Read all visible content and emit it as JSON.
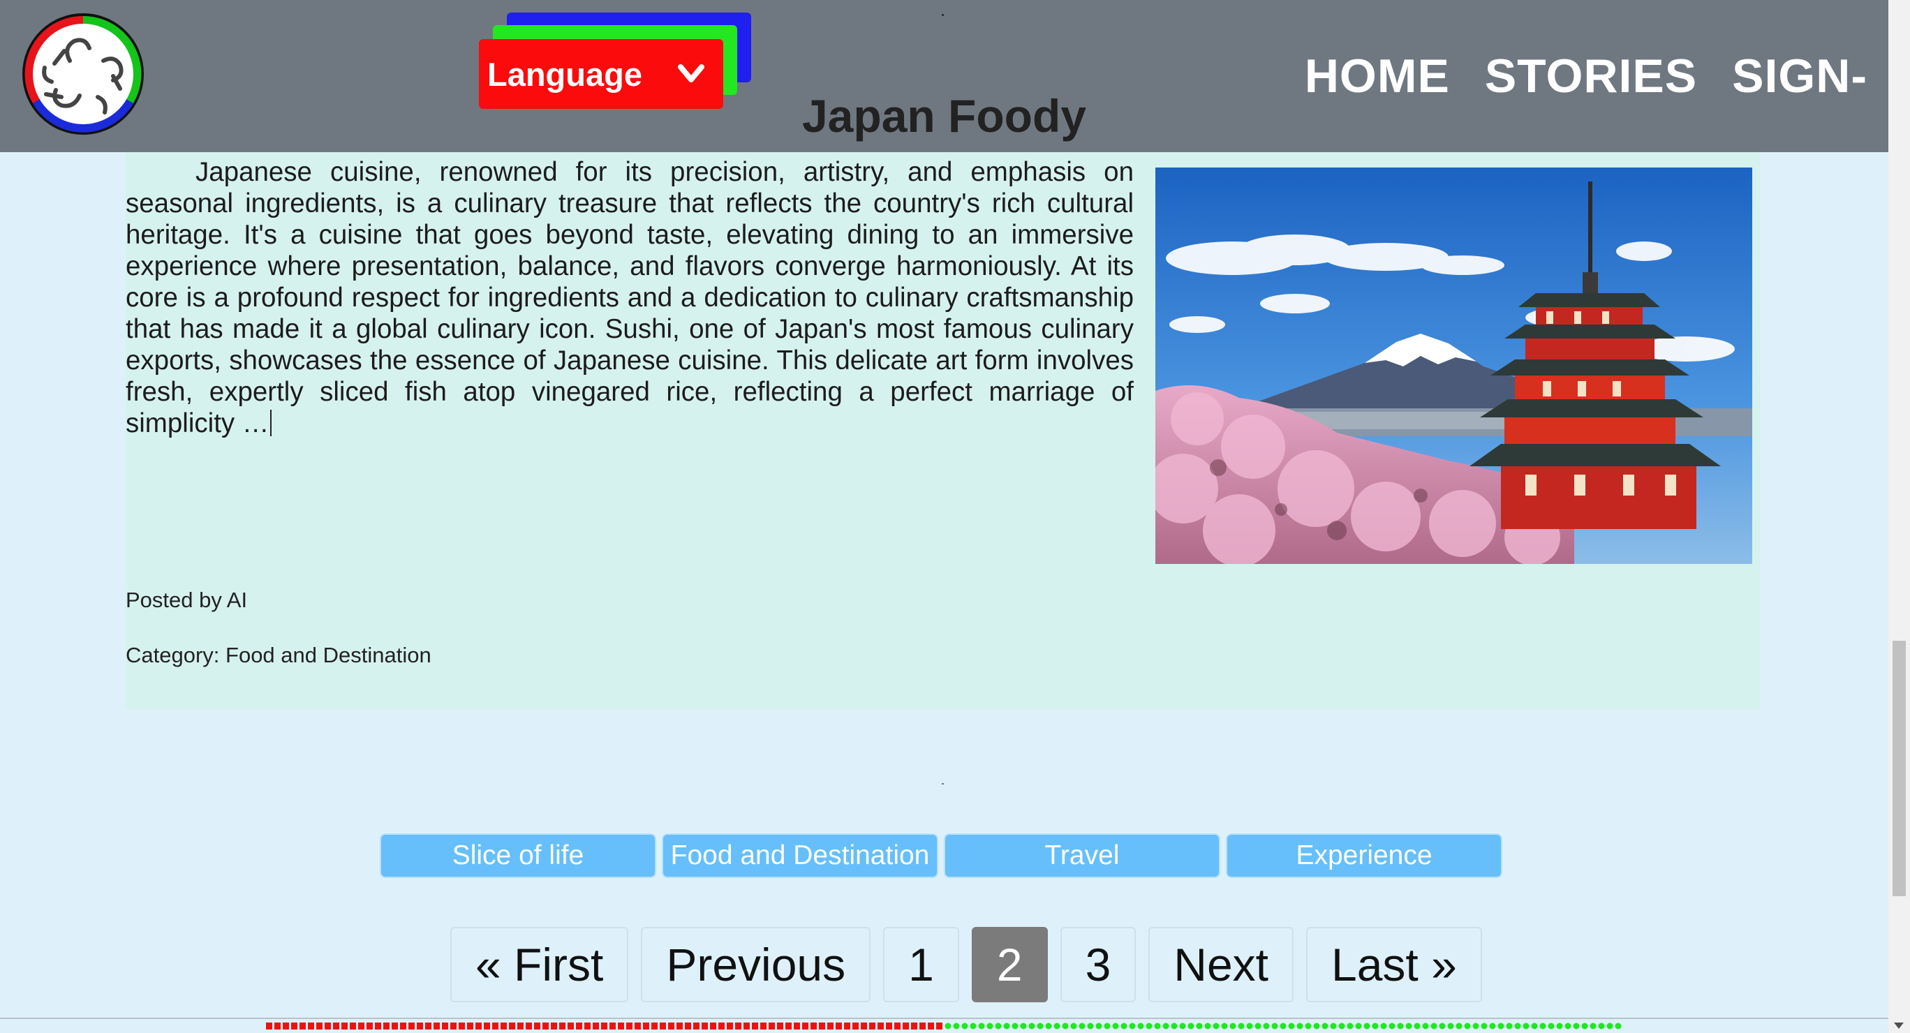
{
  "header": {
    "language_label": "Language",
    "nav": [
      {
        "label": "HOME"
      },
      {
        "label": "STORIES"
      },
      {
        "label": "SIGN-"
      }
    ]
  },
  "article": {
    "title": "Japan Foody",
    "body": "Japanese cuisine, renowned for its precision, artistry, and emphasis on seasonal ingredients, is a culinary treasure that reflects the country's rich cultural heritage. It's a cuisine that goes beyond taste, elevating dining to an immersive experience where presentation, balance, and flavors converge harmoniously. At its core is a profound respect for ingredients and a dedication to culinary craftsmanship that has made it a global culinary icon. Sushi, one of Japan's most famous culinary exports, showcases the essence of Japanese cuisine. This delicate art form involves fresh, expertly sliced fish atop vinegared rice, reflecting a perfect marriage of simplicity …",
    "posted_by": "Posted by AI",
    "category": "Category: Food and Destination",
    "image_alt": "Mount Fuji with Chureito pagoda and cherry blossoms"
  },
  "tags": [
    {
      "label": "Slice of life"
    },
    {
      "label": "Food and Destination"
    },
    {
      "label": "Travel"
    },
    {
      "label": "Experience"
    }
  ],
  "pagination": {
    "first": "« First",
    "previous": "Previous",
    "pages": [
      "1",
      "2",
      "3"
    ],
    "current": "2",
    "next": "Next",
    "last": "Last »"
  },
  "reading_progress": {
    "fraction_read": 0.5,
    "read_color": "#f01010",
    "unread_color": "#1ee81e"
  },
  "colors": {
    "header_bg": "#6f7880",
    "page_bg": "#def1fb",
    "card_bg": "#d6f2ee",
    "tag_bg": "#66bffa",
    "active_page_bg": "#7b7b7b"
  }
}
